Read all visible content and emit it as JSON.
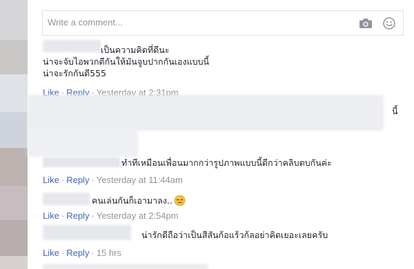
{
  "composer": {
    "placeholder": "Write a comment...",
    "camera_icon": "camera-icon",
    "emoji_icon": "smiley-icon"
  },
  "comments": [
    {
      "lines": [
        "เป็นความคิดที่ดีนะ",
        "น่าจะจับไอพวกดีกันให้มันจูบปากกันเองแบบนี้",
        "น่าจะรักกันดี555"
      ],
      "like": "Like",
      "reply": "Reply",
      "time": "Yesterday at 2:31pm"
    },
    {
      "tail": "นี้"
    },
    {
      "text": "ทำทีเหมือนเพื่อนมากกว่ารูปภาพแบบนี้ดีกว่าคลิบตบกันค่ะ",
      "like": "Like",
      "reply": "Reply",
      "time": "Yesterday at 11:44am"
    },
    {
      "text": "คนเล่นกันก็เอามาลง..",
      "emoji": "sleepy-face-icon",
      "like": "Like",
      "reply": "Reply",
      "time": "Yesterday at 2:54pm"
    },
    {
      "text": "น่ารักดีถือว่าเป็นสีสันก้อแร้วก้ลอย่าคิดเยอะเลยครับ",
      "like": "Like",
      "reply": "Reply",
      "time": "15 hrs"
    }
  ],
  "colors": {
    "link": "#4267b2",
    "meta": "#90949c",
    "text": "#1d2129",
    "border": "#dddfe2"
  }
}
